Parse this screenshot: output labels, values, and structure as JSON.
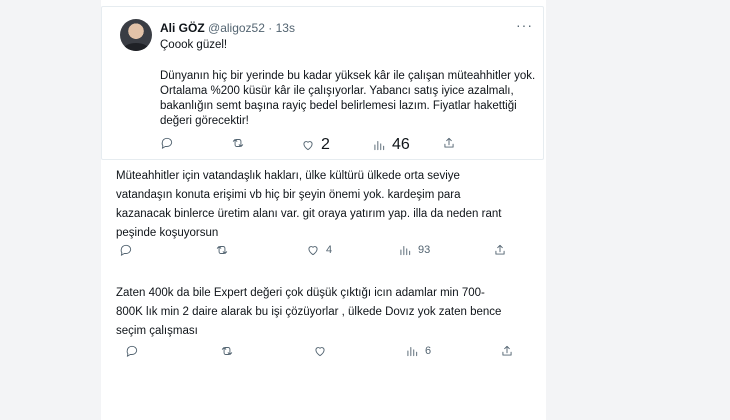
{
  "tweet": {
    "author_name": "Ali GÖZ",
    "author_handle": "@aligoz52",
    "separator": "·",
    "time": "13s",
    "more_label": "···",
    "line_first": "Çoook güzel!",
    "body_lines": [
      "Dünyanın hiç bir yerinde bu kadar yüksek kâr ile çalışan müteahhitler yok.",
      "Ortalama %200 küsür kâr ile çalışıyorlar. Yabancı satış iyice azalmalı,",
      "bakanlığın semt başına rayiç bedel belirlemesi lazım. Fiyatlar hakettiği",
      "değeri görecektir!"
    ],
    "replies_count": "",
    "retweets_count": "",
    "likes_count": "2",
    "views_count": "46"
  },
  "reply1": {
    "lines": [
      "Müteahhitler için vatandaşlık hakları, ülke kültürü ülkede orta seviye",
      "vatandaşın konuta erişimi vb hiç bir şeyin önemi yok. kardeşim para",
      "kazanacak binlerce üretim alanı var. git oraya yatırım yap. illa da neden rant",
      "peşinde koşuyorsun"
    ],
    "likes_count": "4",
    "views_count": "93"
  },
  "reply2": {
    "lines": [
      "Zaten 400k da bile Expert değeri çok düşük çıktığı icın adamlar min 700-",
      "800K lık min 2 daire alarak bu işi çözüyorlar , ülkede Dovız yok zaten bence",
      "seçim çalışması"
    ],
    "likes_count": "",
    "views_count": "6"
  },
  "icons": {
    "reply": "reply-icon",
    "retweet": "retweet-icon",
    "like": "heart-icon",
    "views": "views-icon",
    "share": "share-icon"
  },
  "colors": {
    "text": "#0f1419",
    "secondary": "#536471",
    "side": "#f3f4f6"
  }
}
